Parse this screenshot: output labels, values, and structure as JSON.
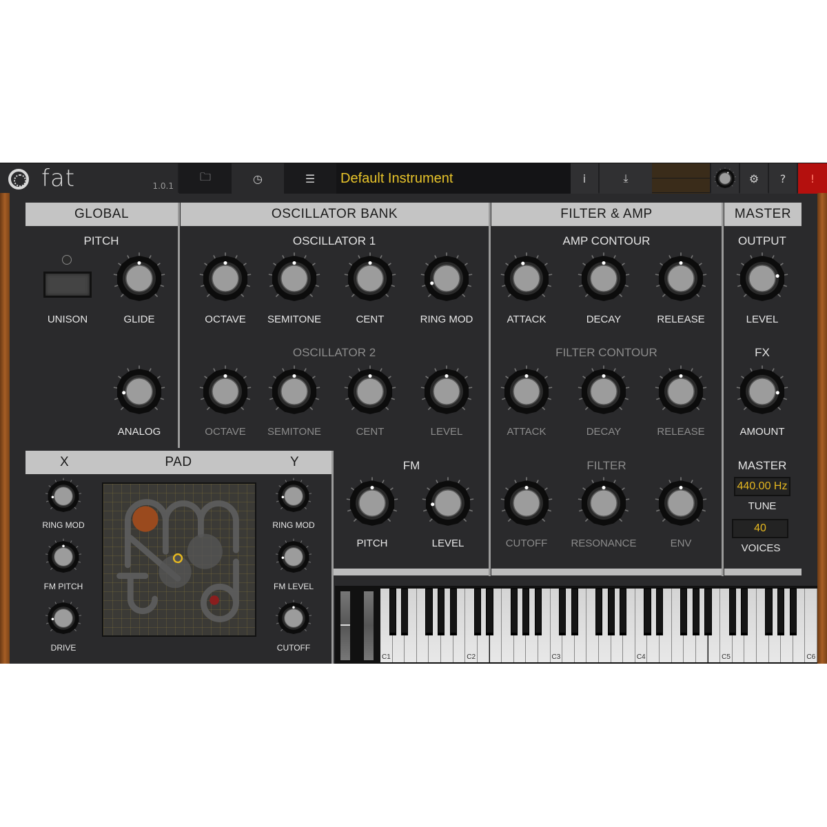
{
  "app": {
    "name": "fat",
    "version": "1.0.1",
    "preset_name": "Default Instrument",
    "accent_color": "#e8c42a"
  },
  "toolbar": {
    "icons": {
      "logo": "ring-logo-icon",
      "browse": "folder-icon",
      "history": "clock-icon",
      "settings_panel": "sliders-icon",
      "info": "info-icon",
      "save": "save-download-icon",
      "volume": "volume-knob-icon",
      "gear": "gear-icon",
      "help": "help-icon",
      "alert": "alert-icon"
    },
    "info_glyph": "i",
    "help_glyph": "?",
    "alert_glyph": "!",
    "folder_glyph": "🗀",
    "clock_glyph": "◷",
    "sliders_glyph": "☰",
    "save_glyph": "⤓",
    "gear_glyph": "⚙"
  },
  "panels": {
    "global": {
      "title": "GLOBAL",
      "pitch_label": "PITCH",
      "unison_label": "UNISON",
      "glide_label": "GLIDE",
      "analog_label": "ANALOG"
    },
    "osc_bank": {
      "title": "OSCILLATOR BANK",
      "osc1": {
        "title": "OSCILLATOR 1",
        "knobs": [
          "OCTAVE",
          "SEMITONE",
          "CENT",
          "RING MOD"
        ]
      },
      "osc2": {
        "title": "OSCILLATOR 2",
        "knobs": [
          "OCTAVE",
          "SEMITONE",
          "CENT",
          "LEVEL"
        ]
      },
      "fm": {
        "title": "FM",
        "knobs": [
          "PITCH",
          "LEVEL"
        ]
      }
    },
    "filter_amp": {
      "title": "FILTER & AMP",
      "amp_contour": {
        "title": "AMP CONTOUR",
        "knobs": [
          "ATTACK",
          "DECAY",
          "RELEASE"
        ]
      },
      "filter_contour": {
        "title": "FILTER CONTOUR",
        "knobs": [
          "ATTACK",
          "DECAY",
          "RELEASE"
        ]
      },
      "filter": {
        "title": "FILTER",
        "knobs": [
          "CUTOFF",
          "RESONANCE",
          "ENV"
        ]
      }
    },
    "master": {
      "title": "MASTER",
      "output_label": "OUTPUT",
      "level_label": "LEVEL",
      "fx_label": "FX",
      "amount_label": "AMOUNT",
      "master_label": "MASTER",
      "tune_value": "440.00 Hz",
      "tune_label": "TUNE",
      "voices_value": "40",
      "voices_label": "VOICES"
    },
    "pad": {
      "title": "PAD",
      "x_label": "X",
      "y_label": "Y",
      "x_knobs": [
        "RING MOD",
        "FM PITCH",
        "DRIVE"
      ],
      "y_knobs": [
        "RING MOD",
        "FM LEVEL",
        "CUTOFF"
      ],
      "cursor_color": "#e6b820",
      "x_marker_color": "#9a4a1e",
      "y_marker_color": "#8a1e1e"
    }
  },
  "knob_values": {
    "glide": 0.5,
    "analog": 0.15,
    "osc1_octave": 0.5,
    "osc1_semitone": 0.5,
    "osc1_cent": 0.5,
    "osc1_ring_mod": 0.1,
    "osc2_octave": 0.5,
    "osc2_semitone": 0.5,
    "osc2_cent": 0.5,
    "osc2_level": 0.5,
    "fm_pitch": 0.5,
    "fm_level": 0.15,
    "amp_attack": 0.45,
    "amp_decay": 0.5,
    "amp_release": 0.5,
    "filter_attack": 0.5,
    "filter_decay": 0.5,
    "filter_release": 0.5,
    "cutoff": 0.5,
    "resonance": 0.5,
    "env": 0.5,
    "output_level": 0.8,
    "fx_amount": 0.85,
    "pad_x_ring_mod": 0.15,
    "pad_x_fm_pitch": 0.5,
    "pad_x_drive": 0.15,
    "pad_y_ring_mod": 0.15,
    "pad_y_fm_level": 0.15,
    "pad_y_cutoff": 0.5,
    "toolbar_volume": 0.6
  },
  "keyboard": {
    "octave_labels": [
      "C1",
      "C2",
      "C3",
      "C4",
      "C5",
      "C6"
    ],
    "white_key_count": 36
  }
}
